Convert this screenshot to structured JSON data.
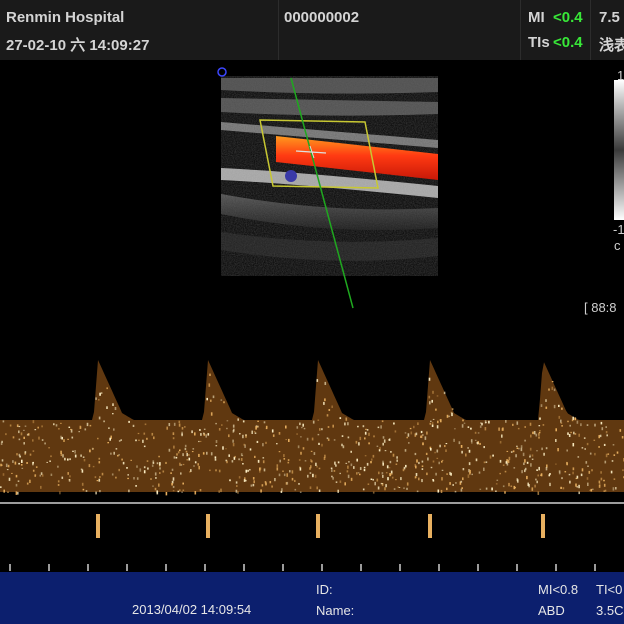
{
  "header": {
    "hospital": "Renmin Hospital",
    "datetime": "27-02-10 六 14:09:27",
    "patient_id": "000000002",
    "mi_label": "MI",
    "mi_value": "<0.4",
    "tis_label": "TIs",
    "tis_value": "<0.4",
    "freq": "7.5",
    "preset": "浅表"
  },
  "right_panel": {
    "scale_top": "1",
    "scale_bottom": "-1",
    "scale_unit": "c",
    "readout": "[ 88:8"
  },
  "colors": {
    "header_bg": "#1a1a1a",
    "flow_red": "#ff3a12",
    "gate_green": "#1fa81f",
    "box_yellow": "#c8c832",
    "footer_bg": "#0c1f6e",
    "doppler_gold": "#e8b060"
  },
  "footer": {
    "date": "2013/04/02 14:09:54",
    "id_label": "ID:",
    "name_label": "Name:",
    "mi": "MI<0.8",
    "ti": "TI<0",
    "mode": "ABD",
    "probe": "3.5C"
  }
}
